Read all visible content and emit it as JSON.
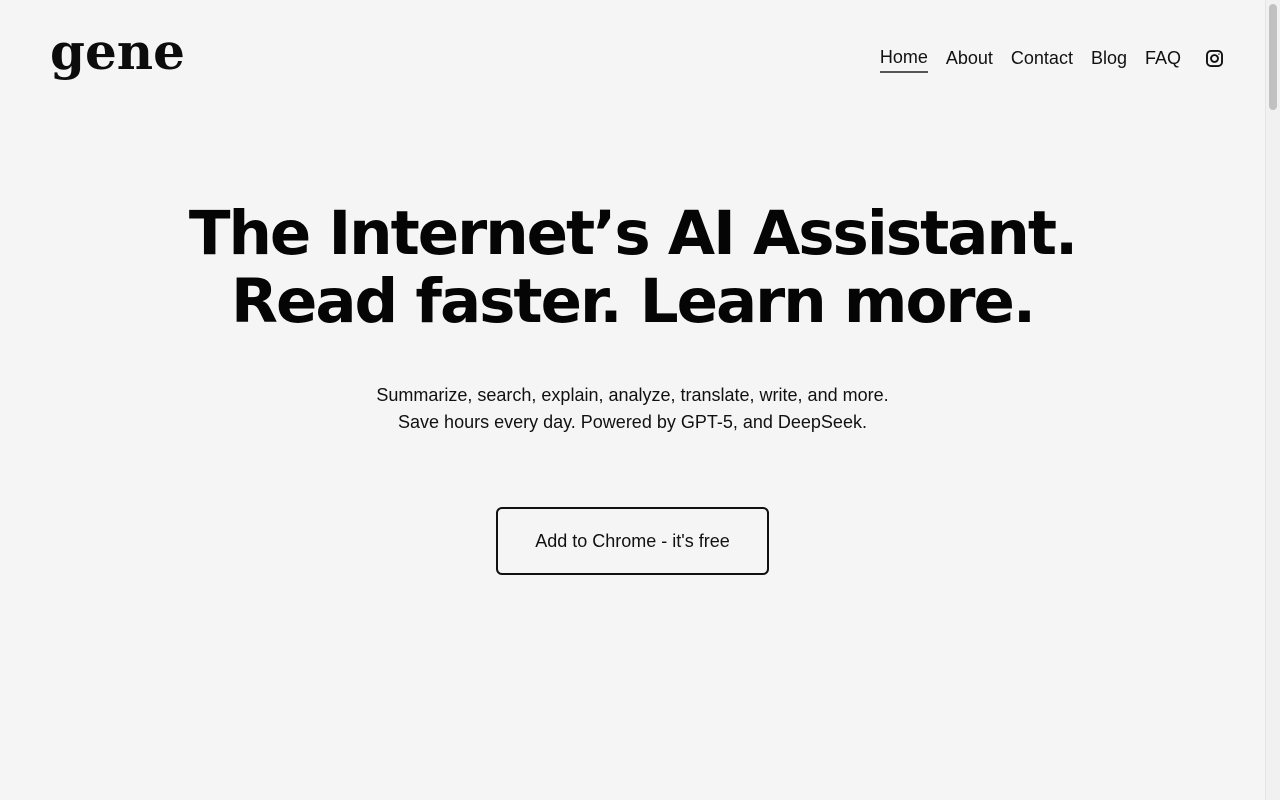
{
  "header": {
    "logo_text": "gene",
    "nav": [
      {
        "label": "Home",
        "active": true
      },
      {
        "label": "About",
        "active": false
      },
      {
        "label": "Contact",
        "active": false
      },
      {
        "label": "Blog",
        "active": false
      },
      {
        "label": "FAQ",
        "active": false
      }
    ],
    "social_icon": "instagram-icon"
  },
  "hero": {
    "headline_line1": "The Internet’s AI Assistant.",
    "headline_line2": "Read faster. Learn more.",
    "subtext_line1": "Summarize, search, explain, analyze, translate, write, and more.",
    "subtext_line2": "Save hours every day. Powered by GPT-5, and DeepSeek.",
    "cta_label": "Add to Chrome - it's free"
  },
  "colors": {
    "background": "#f5f5f5",
    "text": "#111111",
    "active_underline": "#555555"
  }
}
